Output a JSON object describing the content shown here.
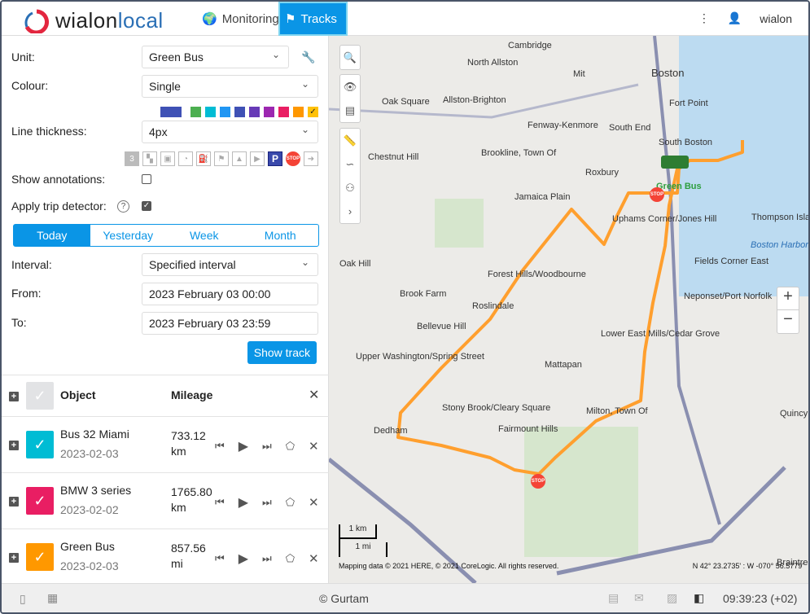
{
  "header": {
    "logo": "wialonlocal",
    "nav": [
      {
        "label": "Monitoring",
        "icon": "globe-icon"
      },
      {
        "label": "Tracks",
        "icon": "flag-icon",
        "active": true
      }
    ],
    "user": "wialon"
  },
  "form": {
    "unit_label": "Unit:",
    "unit_value": "Green Bus",
    "colour_label": "Colour:",
    "colour_value": "Single",
    "swatches": [
      "#3f51b5",
      "#4caf50",
      "#00bcd4",
      "#2196f3",
      "#3f51b5",
      "#673ab7",
      "#9c27b0",
      "#e91e63",
      "#ff9800",
      "#ffc107"
    ],
    "thickness_label": "Line thickness:",
    "thickness_value": "4px",
    "stop_icon": "STOP",
    "parking_icon": "P",
    "count_icon": "3",
    "annotations_label": "Show annotations:",
    "trip_label": "Apply trip detector:",
    "trip_help": "?",
    "tabs": [
      "Today",
      "Yesterday",
      "Week",
      "Month"
    ],
    "interval_label": "Interval:",
    "interval_value": "Specified interval",
    "from_label": "From:",
    "from_value": "2023 February 03 00:00",
    "to_label": "To:",
    "to_value": "2023 February 03 23:59",
    "show_track": "Show track"
  },
  "list": {
    "col_object": "Object",
    "col_mileage": "Mileage",
    "items": [
      {
        "name": "Bus 32 Miami",
        "date": "2023-02-03",
        "mileage": "733.12",
        "unit": "km",
        "color": "#00bcd4"
      },
      {
        "name": "BMW 3 series",
        "date": "2023-02-02",
        "mileage": "1765.80",
        "unit": "km",
        "color": "#e91e63"
      },
      {
        "name": "Green Bus",
        "date": "2023-02-03",
        "mileage": "857.56",
        "unit": "mi",
        "color": "#ff9800"
      }
    ]
  },
  "map": {
    "unit_label": "Green Bus",
    "track_color": "#ff9f2e",
    "scale_km": "1 km",
    "scale_mi": "1 mi",
    "attribution": "Mapping data © 2021 HERE, © 2021 CoreLogic. All rights reserved.",
    "coords": "N 42° 23.2735' : W -070° 56.5779'",
    "labels": [
      "Cambridge",
      "North Allston",
      "Mit",
      "Boston",
      "Oak Square",
      "Allston-Brighton",
      "Fort Point",
      "Fenway-Kenmore",
      "South End",
      "Chestnut Hill",
      "Brookline, Town Of",
      "South Boston",
      "Roxbury",
      "Jamaica Plain",
      "Uphams Corner/Jones Hill",
      "Thompson Island",
      "Boston Harbor",
      "Oak Hill",
      "Forest Hills/Woodbourne",
      "Fields Corner East",
      "Brook Farm",
      "Roslindale",
      "Neponset/Port Norfolk",
      "Bellevue Hill",
      "Lower East Mills/Cedar Grove",
      "Upper Washington/Spring Street",
      "Mattapan",
      "Stony Brook/Cleary Square",
      "Milton, Town Of",
      "Dedham",
      "Fairmount Hills",
      "Quincy",
      "Braintree Town"
    ]
  },
  "footer": {
    "copyright": "© Gurtam",
    "time": "09:39:23 (+02)"
  }
}
